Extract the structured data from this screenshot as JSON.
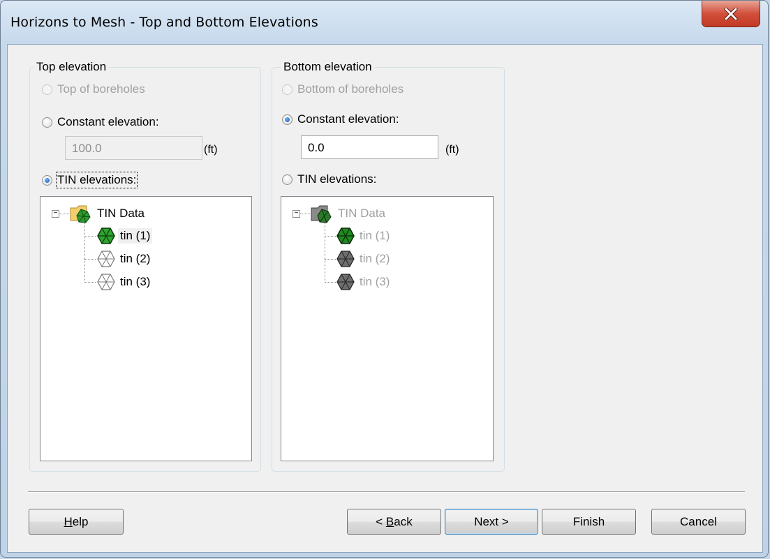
{
  "window": {
    "title": "Horizons to Mesh - Top and Bottom Elevations"
  },
  "top_group": {
    "label": "Top elevation",
    "option_boreholes": "Top of boreholes",
    "option_constant": "Constant elevation:",
    "constant_value": "100.0",
    "unit": "(ft)",
    "option_tin": "TIN elevations:",
    "selected_option": "TIN elevations:",
    "tree": {
      "root": "TIN Data",
      "items": [
        "tin (1)",
        "tin (2)",
        "tin (3)"
      ]
    }
  },
  "bottom_group": {
    "label": "Bottom elevation",
    "option_boreholes": "Bottom of boreholes",
    "option_constant": "Constant elevation:",
    "constant_value": "0.0",
    "unit": "(ft)",
    "option_tin": "TIN elevations:",
    "selected_option": "Constant elevation:",
    "tree": {
      "root": "TIN Data",
      "items": [
        "tin (1)",
        "tin (2)",
        "tin (3)"
      ]
    }
  },
  "buttons": {
    "help_prefix": "H",
    "help_rest": "elp",
    "back_prefix": "< ",
    "back_mnemonic": "B",
    "back_rest": "ack",
    "next": "Next >",
    "finish": "Finish",
    "cancel": "Cancel"
  },
  "icons": {
    "close": "close-x-icon",
    "tin_active": "tin-green-hexagon-icon",
    "tin_inactive": "tin-outline-hexagon-icon",
    "folder": "tin-folder-icon"
  }
}
